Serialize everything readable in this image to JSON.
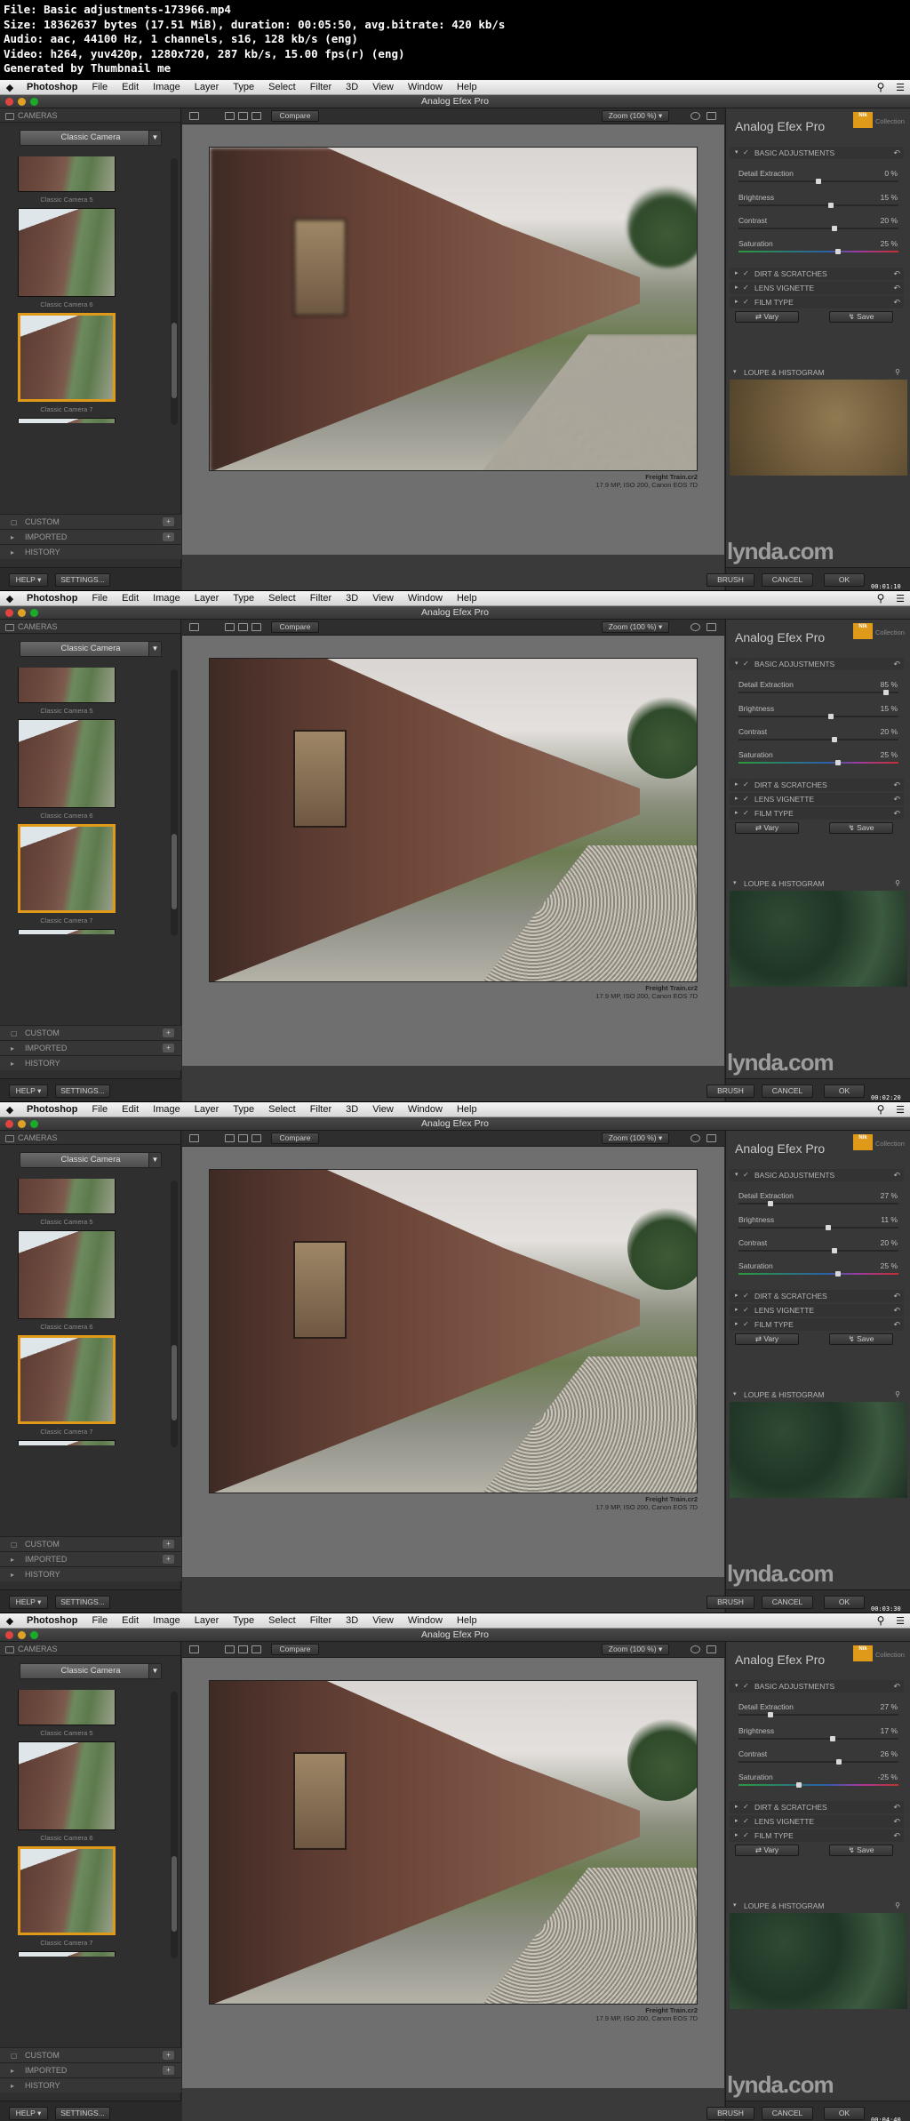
{
  "header": {
    "line1": "File: Basic adjustments-173966.mp4",
    "line2": "Size: 18362637 bytes (17.51 MiB), duration: 00:05:50, avg.bitrate: 420 kb/s",
    "line3": "Audio: aac, 44100 Hz, 1 channels, s16, 128 kb/s (eng)",
    "line4": "Video: h264, yuv420p, 1280x720, 287 kb/s, 15.00 fps(r) (eng)",
    "line5": "Generated by Thumbnail me"
  },
  "menubar": {
    "app": "Photoshop",
    "items": [
      "File",
      "Edit",
      "Image",
      "Layer",
      "Type",
      "Select",
      "Filter",
      "3D",
      "View",
      "Window",
      "Help"
    ]
  },
  "window_title": "Analog Efex Pro",
  "left_panel": {
    "cameras_label": "CAMERAS",
    "dropdown_value": "Classic Camera",
    "thumbnail_captions": [
      "Classic Camera 5",
      "Classic Camera 6",
      "Classic Camera 7"
    ],
    "custom_label": "CUSTOM",
    "imported_label": "IMPORTED",
    "history_label": "HISTORY",
    "help_label": "HELP",
    "settings_label": "SETTINGS..."
  },
  "toolbar": {
    "compare_label": "Compare",
    "zoom_label": "Zoom (100 %)"
  },
  "photo": {
    "filename": "Freight Train.cr2",
    "meta": "17.9 MP, ISO 200, Canon EOS 7D"
  },
  "right_panel": {
    "title": "Analog Efex Pro",
    "logo_text": "Nik",
    "collection_label": "Collection",
    "basic_adjustments_label": "BASIC ADJUSTMENTS",
    "detail_label": "Detail Extraction",
    "brightness_label": "Brightness",
    "contrast_label": "Contrast",
    "saturation_label": "Saturation",
    "dirt_label": "DIRT & SCRATCHES",
    "vignette_label": "LENS VIGNETTE",
    "film_label": "FILM TYPE",
    "vary_label": "Vary",
    "save_label": "Save",
    "loupe_label": "LOUPE & HISTOGRAM"
  },
  "bottom_buttons": {
    "brush": "BRUSH",
    "cancel": "CANCEL",
    "ok": "OK"
  },
  "watermark": "lynda.com",
  "frames": [
    {
      "timestamp": "00:01:10",
      "detail": "0 %",
      "brightness": "15 %",
      "contrast": "20 %",
      "saturation": "25 %",
      "detail_pos": 0.5,
      "brightness_pos": 0.58,
      "contrast_pos": 0.6,
      "saturation_pos": 0.62,
      "loupe": "brown",
      "blur": true
    },
    {
      "timestamp": "00:02:20",
      "detail": "85 %",
      "brightness": "15 %",
      "contrast": "20 %",
      "saturation": "25 %",
      "detail_pos": 0.92,
      "brightness_pos": 0.58,
      "contrast_pos": 0.6,
      "saturation_pos": 0.62,
      "loupe": "green",
      "blur": false
    },
    {
      "timestamp": "00:03:30",
      "detail": "27 %",
      "brightness": "11 %",
      "contrast": "20 %",
      "saturation": "25 %",
      "detail_pos": 0.2,
      "brightness_pos": 0.56,
      "contrast_pos": 0.6,
      "saturation_pos": 0.62,
      "loupe": "green",
      "blur": false
    },
    {
      "timestamp": "00:04:40",
      "detail": "27 %",
      "brightness": "17 %",
      "contrast": "26 %",
      "saturation": "-25 %",
      "detail_pos": 0.2,
      "brightness_pos": 0.59,
      "contrast_pos": 0.63,
      "saturation_pos": 0.38,
      "loupe": "green",
      "blur": false
    }
  ]
}
